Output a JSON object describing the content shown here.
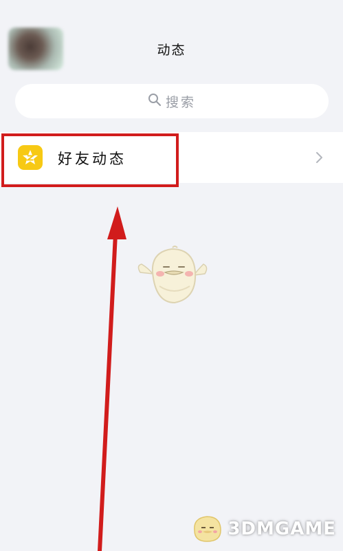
{
  "header": {
    "title": "动态"
  },
  "search": {
    "placeholder": "搜索"
  },
  "list": {
    "items": [
      {
        "label": "好友动态"
      }
    ]
  },
  "watermark": {
    "text": "3DMGAME"
  },
  "colors": {
    "background": "#f2f3f7",
    "qzone_icon": "#f7c914",
    "annotation": "#d11c1c"
  },
  "icons": [
    "avatar",
    "search-icon",
    "qzone-icon",
    "chevron-right-icon",
    "mascot-illustration",
    "annotation-arrow"
  ]
}
